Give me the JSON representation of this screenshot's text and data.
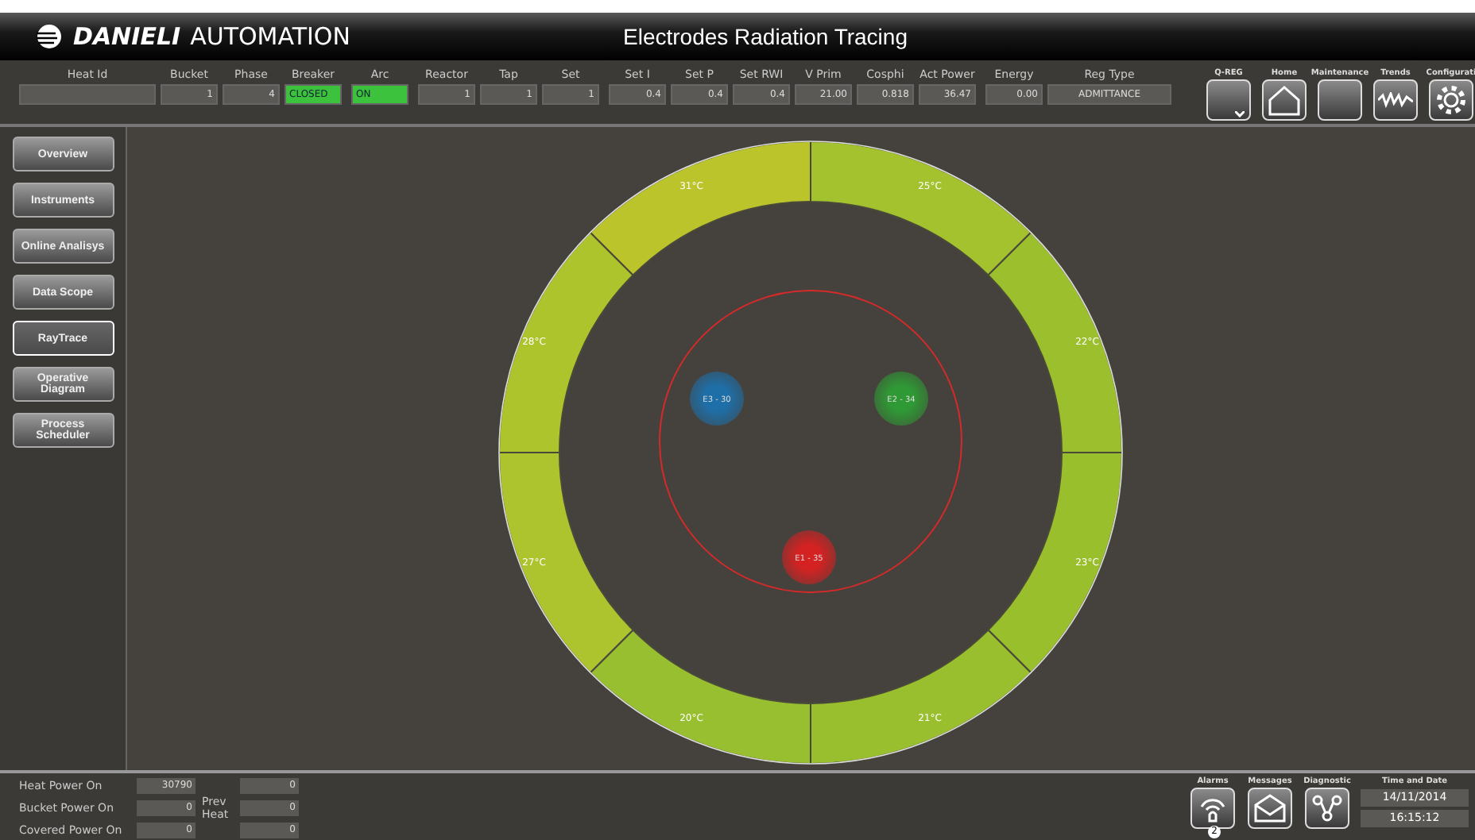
{
  "header": {
    "brand_bold": "DANIELI",
    "brand": "AUTOMATION",
    "title": "Electrodes Radiation Tracing"
  },
  "fields": [
    {
      "label": "Heat Id",
      "kind": "text"
    },
    {
      "label": "Bucket",
      "value": "1",
      "kind": "number"
    },
    {
      "label": "Phase",
      "value": "4",
      "kind": "number"
    },
    {
      "label": "Breaker",
      "value": "CLOSED",
      "kind": "status"
    },
    {
      "label": "Arc",
      "value": "ON",
      "kind": "status"
    },
    {
      "label": "Reactor",
      "value": "1",
      "kind": "number"
    },
    {
      "label": "Tap",
      "value": "1",
      "kind": "number"
    },
    {
      "label": "Set",
      "value": "1",
      "kind": "number"
    },
    {
      "label": "Set I",
      "value": "0.4",
      "kind": "number"
    },
    {
      "label": "Set P",
      "value": "0.4",
      "kind": "number"
    },
    {
      "label": "Set RWI",
      "value": "0.4",
      "kind": "number"
    },
    {
      "label": "V Prim",
      "value": "21.00",
      "kind": "number"
    },
    {
      "label": "Cosphi",
      "value": "0.818",
      "kind": "number"
    },
    {
      "label": "Act Power",
      "value": "36.47",
      "kind": "number"
    },
    {
      "label": "Energy",
      "value": "0.00",
      "kind": "number"
    },
    {
      "label": "Reg Type",
      "value": "ADMITTANCE",
      "kind": "text"
    }
  ],
  "toolbar": [
    {
      "label": "Q-REG",
      "kind": "qreg"
    },
    {
      "label": "Home",
      "kind": "home"
    },
    {
      "label": "Maintenance",
      "kind": "blank"
    },
    {
      "label": "Trends",
      "kind": "trends"
    },
    {
      "label": "Configurati",
      "kind": "gear"
    }
  ],
  "sidebar": {
    "items": [
      {
        "label": "Overview",
        "selected": false
      },
      {
        "label": "Instruments",
        "selected": false
      },
      {
        "label": "Online Analisys",
        "selected": false
      },
      {
        "label": "Data Scope",
        "selected": false
      },
      {
        "label": "RayTrace",
        "selected": true
      },
      {
        "label": "Operative Diagram",
        "selected": false
      },
      {
        "label": "Process Scheduler",
        "selected": false
      }
    ]
  },
  "ring": [
    {
      "label": "25°C",
      "color": "#a3c22e"
    },
    {
      "label": "22°C",
      "color": "#9cc02d"
    },
    {
      "label": "23°C",
      "color": "#9abf2d"
    },
    {
      "label": "21°C",
      "color": "#99bf2e"
    },
    {
      "label": "20°C",
      "color": "#98bf2f"
    },
    {
      "label": "27°C",
      "color": "#adc42e"
    },
    {
      "label": "28°C",
      "color": "#aec42d"
    },
    {
      "label": "31°C",
      "color": "#bcc42c"
    }
  ],
  "electrodes": [
    {
      "label": "E3 - 30",
      "color": "#1e6fa8"
    },
    {
      "label": "E2 - 34",
      "color": "#2f9a35"
    },
    {
      "label": "E1 - 35",
      "color": "#d42222"
    }
  ],
  "bottom": {
    "rows": [
      {
        "label": "Heat Power On",
        "value": "30790",
        "prev": "0"
      },
      {
        "label": "Bucket Power On",
        "value": "0",
        "prev": "0"
      },
      {
        "label": "Covered Power On",
        "value": "0",
        "prev": "0"
      }
    ],
    "prev_label": "Prev Heat",
    "buttons": [
      {
        "label": "Alarms",
        "kind": "alarm",
        "badge": "2"
      },
      {
        "label": "Messages",
        "kind": "mail"
      },
      {
        "label": "Diagnostic",
        "kind": "diag"
      }
    ],
    "datetime": {
      "label": "Time and Date",
      "date": "14/11/2014",
      "time": "16:15:12"
    }
  }
}
